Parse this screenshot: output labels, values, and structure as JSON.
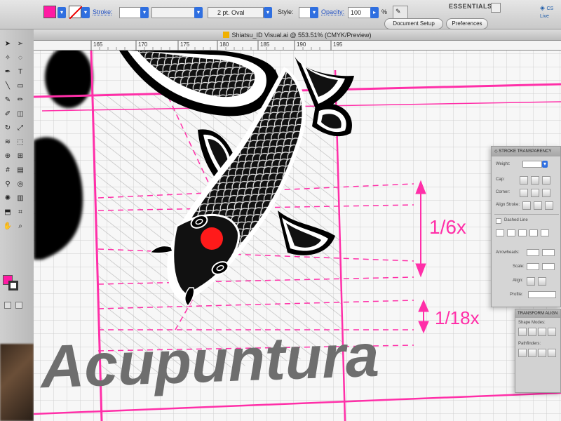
{
  "app": {
    "workspace": "ESSENTIALS ▾",
    "cs_live": "CS Live"
  },
  "control_bar": {
    "stroke_label": "Stroke:",
    "stroke_value": "",
    "brush_value": "2 pt. Oval",
    "style_label": "Style:",
    "opacity_label": "Opacity:",
    "opacity_value": "100",
    "percent_sign": "%",
    "document_setup": "Document Setup",
    "preferences": "Preferences",
    "fill_color": "#ff1aa3"
  },
  "document": {
    "title": "Shiatsu_ID Visual.ai @ 553.51% (CMYK/Preview)"
  },
  "ruler": {
    "ticks": [
      "165",
      "170",
      "175",
      "180",
      "185",
      "190",
      "195"
    ]
  },
  "artwork": {
    "brand_text": "Acupuntura",
    "dimension_top": "1/6x",
    "dimension_bottom": "1/18x",
    "guide_color": "#ff2fa8",
    "koi_eye_color": "#ff1a1a"
  },
  "stroke_panel": {
    "tabs": "◇ STROKE  TRANSPARENCY",
    "weight_label": "Weight:",
    "cap_label": "Cap:",
    "corner_label": "Corner:",
    "align_label": "Align Stroke:",
    "dashed_label": "Dashed Line",
    "arrowheads_label": "Arrowheads:",
    "scale_label": "Scale:",
    "align_label2": "Align:",
    "profile_label": "Profile:"
  },
  "transform_panel": {
    "tabs": "TRANSFORM  ALIGN",
    "shape_modes": "Shape Modes:",
    "pathfinders": "Pathfinders:"
  }
}
